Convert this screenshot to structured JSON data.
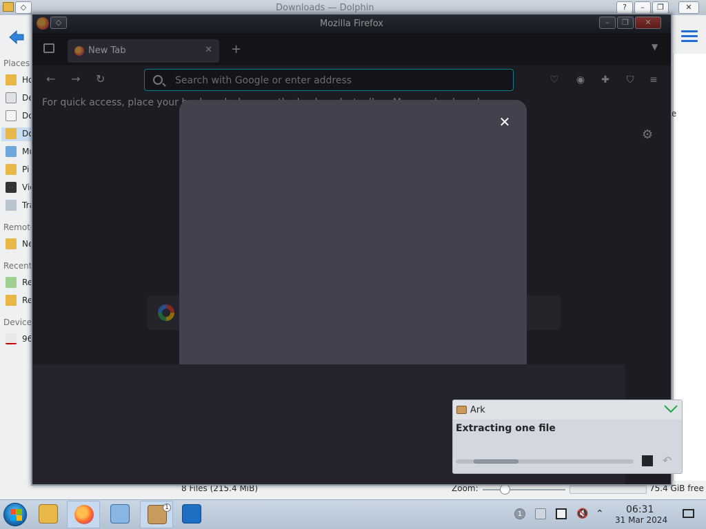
{
  "dolphin": {
    "title": "Downloads — Dolphin",
    "sections": {
      "places": "Places",
      "remote": "Remote",
      "recent": "Recent",
      "devices": "Devices"
    },
    "places_items": [
      "Ho",
      "De",
      "Do",
      "Do",
      "Mu",
      "Pi",
      "Vid",
      "Tra"
    ],
    "remote_items": [
      "Ne"
    ],
    "recent_items": [
      "Re",
      "Re"
    ],
    "device_items": [
      "96"
    ],
    "content_text": "xe",
    "status": {
      "files": "8 Files (215.4 MiB)",
      "zoom_label": "Zoom:",
      "free": "75.4 GiB free"
    }
  },
  "firefox": {
    "title": "Mozilla Firefox",
    "tab_label": "New Tab",
    "search_placeholder": "Search with Google or enter address",
    "bookmarks_hint": "For quick access, place your bookmarks here on the bookmarks toolbar. Manage bookmarks…"
  },
  "ark_notification": {
    "app": "Ark",
    "message": "Extracting one file",
    "progress": 0.25
  },
  "taskbar": {
    "time": "06:31",
    "date": "31 Mar 2024",
    "ark_badge": "1",
    "tray_badge": "1"
  },
  "colors": {
    "firefox_bg": "#2b2a33",
    "modal_bg": "#42414d",
    "taskbar": "#c4d2e1",
    "accent": "#1d6ed0"
  }
}
